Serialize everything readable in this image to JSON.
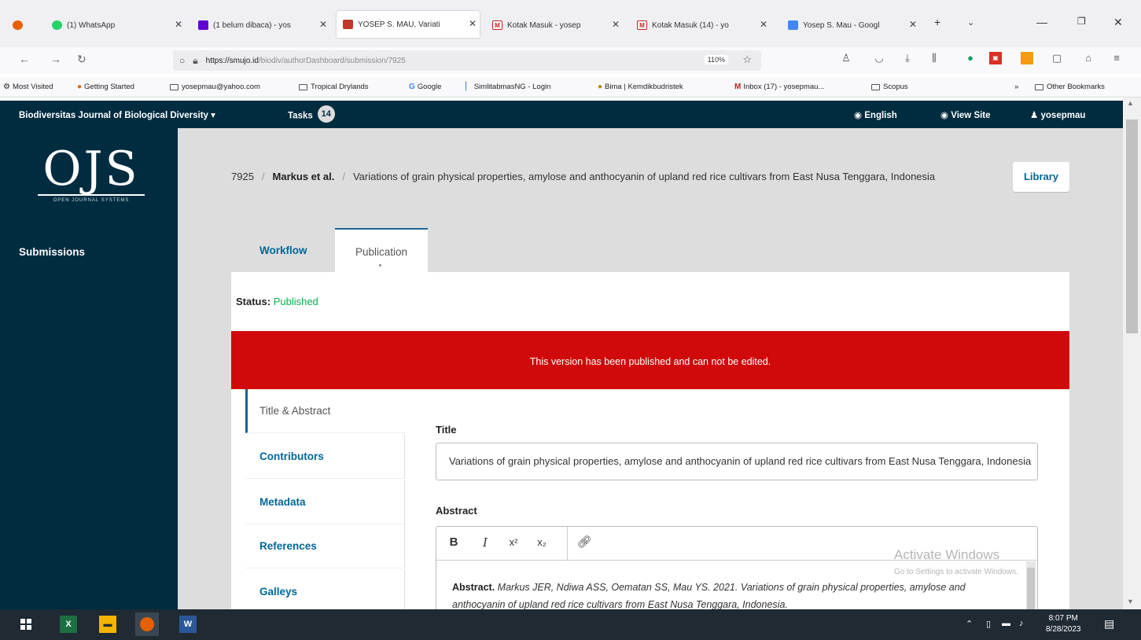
{
  "browser": {
    "tabs": [
      {
        "title": "(1) WhatsApp",
        "color": "#25d366"
      },
      {
        "title": "(1 belum dibaca) - yos",
        "color": "#6001d2"
      },
      {
        "title": "YOSEP S. MAU, Variati",
        "color": "#c0392b"
      },
      {
        "title": "Kotak Masuk - yosep",
        "color": "#c5221f"
      },
      {
        "title": "Kotak Masuk (14) - yo",
        "color": "#c5221f"
      },
      {
        "title": "Yosep S. Mau - Googl",
        "color": "#4285f4"
      }
    ],
    "url_host": "https://smujo.id",
    "url_path": "/biodiv/authorDashboard/submission/7925",
    "zoom": "110%"
  },
  "bookmarks": [
    "Most Visited",
    "Getting Started",
    "yosepmau@yahoo.com",
    "Tropical Drylands",
    "Google",
    "SimlitabmasNG - Login",
    "Bima | Kemdikbudristek",
    "Inbox (17) - yosepmau...",
    "Scopus"
  ],
  "other_bookmarks": "Other Bookmarks",
  "ojs": {
    "journal": "Biodiversitas Journal of Biological Diversity",
    "tasks_label": "Tasks",
    "tasks_count": "14",
    "language": "English",
    "view_site": "View Site",
    "user": "yosepmau"
  },
  "logo": {
    "big": "OJS",
    "small": "OPEN JOURNAL SYSTEMS"
  },
  "sidebar": {
    "submissions": "Submissions"
  },
  "breadcrumb": {
    "id": "7925",
    "authors": "Markus et al.",
    "title": "Variations of grain physical properties, amylose and anthocyanin of upland red rice cultivars from East Nusa Tenggara, Indonesia"
  },
  "library_btn": "Library",
  "tabs": {
    "workflow": "Workflow",
    "publication": "Publication"
  },
  "status": {
    "label": "Status:",
    "value": "Published"
  },
  "notice": "This version has been published and can not be edited.",
  "subnav": [
    "Title & Abstract",
    "Contributors",
    "Metadata",
    "References",
    "Galleys"
  ],
  "form": {
    "title_label": "Title",
    "title_value": "Variations of grain physical properties, amylose and anthocyanin of upland red rice cultivars from East Nusa Tenggara, Indonesia",
    "abstract_label": "Abstract",
    "abstract_lead": "Abstract.",
    "abstract_text": "Markus JER, Ndiwa ASS, Oematan SS, Mau YS. 2021. Variations of grain physical properties, amylose and anthocyanin of upland red rice cultivars from East Nusa Tenggara, Indonesia."
  },
  "watermark": {
    "line1": "Activate Windows",
    "line2": "Go to Settings to activate Windows."
  },
  "clock": {
    "time": "8:07 PM",
    "date": "8/28/2023"
  }
}
